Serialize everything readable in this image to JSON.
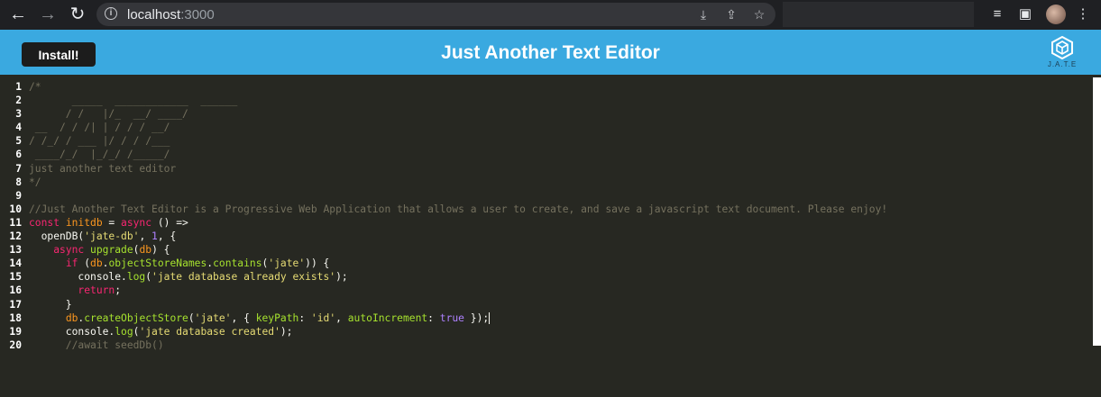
{
  "browser": {
    "url_host": "localhost",
    "url_port": ":3000"
  },
  "header": {
    "install_label": "Install!",
    "title": "Just Another Text Editor",
    "logo_text": "J.A.T.E"
  },
  "editor": {
    "lines": [
      {
        "n": "1",
        "parts": [
          {
            "t": "/*",
            "c": "c"
          }
        ]
      },
      {
        "n": "2",
        "parts": [
          {
            "t": "       _____  ____________  ______",
            "c": "c"
          }
        ]
      },
      {
        "n": "3",
        "parts": [
          {
            "t": "      / /   |/_  __/ ____/",
            "c": "c"
          }
        ]
      },
      {
        "n": "4",
        "parts": [
          {
            "t": " __  / / /| | / / / __/",
            "c": "c"
          }
        ]
      },
      {
        "n": "5",
        "parts": [
          {
            "t": "/ /_/ / ___ |/ / / /___",
            "c": "c"
          }
        ]
      },
      {
        "n": "6",
        "parts": [
          {
            "t": " ____/_/  |_/_/ /_____/",
            "c": "c"
          }
        ]
      },
      {
        "n": "7",
        "parts": [
          {
            "t": "just another text editor",
            "c": "c"
          }
        ]
      },
      {
        "n": "8",
        "parts": [
          {
            "t": "*/",
            "c": "c"
          }
        ]
      },
      {
        "n": "9",
        "parts": []
      },
      {
        "n": "10",
        "parts": [
          {
            "t": "//Just Another Text Editor is a Progressive Web Application that allows a user to create, and save a javascript text document. Please enjoy!",
            "c": "c"
          }
        ]
      },
      {
        "n": "11",
        "parts": [
          {
            "t": "const ",
            "c": "kw"
          },
          {
            "t": "initdb",
            "c": "def"
          },
          {
            "t": " = ",
            "c": ""
          },
          {
            "t": "async",
            "c": "kw"
          },
          {
            "t": " () =>",
            "c": ""
          }
        ]
      },
      {
        "n": "12",
        "parts": [
          {
            "t": "  openDB(",
            "c": ""
          },
          {
            "t": "'jate-db'",
            "c": "str"
          },
          {
            "t": ", ",
            "c": ""
          },
          {
            "t": "1",
            "c": "num"
          },
          {
            "t": ", {",
            "c": ""
          }
        ]
      },
      {
        "n": "13",
        "parts": [
          {
            "t": "    ",
            "c": ""
          },
          {
            "t": "async",
            "c": "kw"
          },
          {
            "t": " ",
            "c": ""
          },
          {
            "t": "upgrade",
            "c": "fn"
          },
          {
            "t": "(",
            "c": ""
          },
          {
            "t": "db",
            "c": "def"
          },
          {
            "t": ") {",
            "c": ""
          }
        ]
      },
      {
        "n": "14",
        "parts": [
          {
            "t": "      ",
            "c": ""
          },
          {
            "t": "if",
            "c": "kw"
          },
          {
            "t": " (",
            "c": ""
          },
          {
            "t": "db",
            "c": "def"
          },
          {
            "t": ".",
            "c": ""
          },
          {
            "t": "objectStoreNames",
            "c": "prop"
          },
          {
            "t": ".",
            "c": ""
          },
          {
            "t": "contains",
            "c": "prop"
          },
          {
            "t": "(",
            "c": ""
          },
          {
            "t": "'jate'",
            "c": "str"
          },
          {
            "t": ")) {",
            "c": ""
          }
        ]
      },
      {
        "n": "15",
        "parts": [
          {
            "t": "        console.",
            "c": ""
          },
          {
            "t": "log",
            "c": "prop"
          },
          {
            "t": "(",
            "c": ""
          },
          {
            "t": "'jate database already exists'",
            "c": "str"
          },
          {
            "t": ");",
            "c": ""
          }
        ]
      },
      {
        "n": "16",
        "parts": [
          {
            "t": "        ",
            "c": ""
          },
          {
            "t": "return",
            "c": "kw"
          },
          {
            "t": ";",
            "c": ""
          }
        ]
      },
      {
        "n": "17",
        "parts": [
          {
            "t": "      }",
            "c": ""
          }
        ]
      },
      {
        "n": "18",
        "parts": [
          {
            "t": "      ",
            "c": ""
          },
          {
            "t": "db",
            "c": "def"
          },
          {
            "t": ".",
            "c": ""
          },
          {
            "t": "createObjectStore",
            "c": "prop"
          },
          {
            "t": "(",
            "c": ""
          },
          {
            "t": "'jate'",
            "c": "str"
          },
          {
            "t": ", { ",
            "c": ""
          },
          {
            "t": "keyPath",
            "c": "prop"
          },
          {
            "t": ": ",
            "c": ""
          },
          {
            "t": "'id'",
            "c": "str"
          },
          {
            "t": ", ",
            "c": ""
          },
          {
            "t": "autoIncrement",
            "c": "prop"
          },
          {
            "t": ": ",
            "c": ""
          },
          {
            "t": "true",
            "c": "num"
          },
          {
            "t": " });",
            "c": ""
          }
        ],
        "cursor": true
      },
      {
        "n": "19",
        "parts": [
          {
            "t": "      console.",
            "c": ""
          },
          {
            "t": "log",
            "c": "prop"
          },
          {
            "t": "(",
            "c": ""
          },
          {
            "t": "'jate database created'",
            "c": "str"
          },
          {
            "t": ");",
            "c": ""
          }
        ]
      },
      {
        "n": "20",
        "parts": [
          {
            "t": "      //await seedDb()",
            "c": "c"
          }
        ]
      }
    ]
  },
  "colors": {
    "header_bg": "#3aa9e0",
    "editor_bg": "#272822",
    "install_bg": "#1c1c1c"
  }
}
